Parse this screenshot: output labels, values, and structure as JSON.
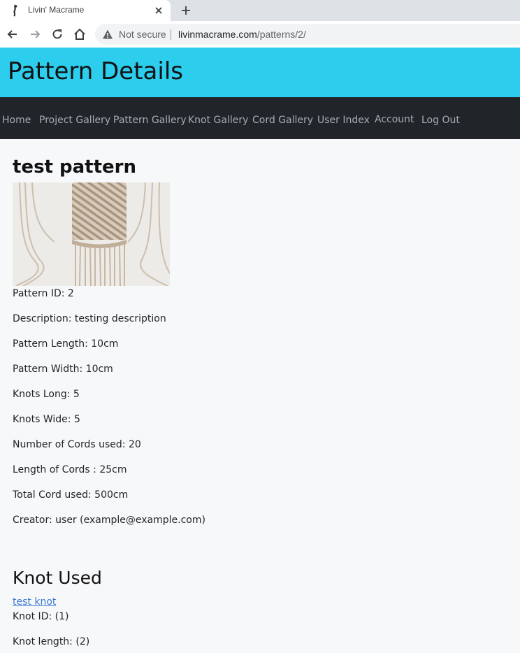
{
  "browser": {
    "tab_title": "Livin' Macrame",
    "security_label": "Not secure",
    "url_host": "livinmacrame.com",
    "url_path": "/patterns/2/"
  },
  "header": {
    "title": "Pattern Details"
  },
  "nav": {
    "items": [
      "Home",
      "Project Gallery",
      "Pattern Gallery",
      "Knot Gallery",
      "Cord Gallery",
      "User Index",
      "Account",
      "Log Out"
    ]
  },
  "pattern": {
    "name": "test pattern",
    "fields": [
      "Pattern ID: 2",
      "Description: testing description",
      "Pattern Length: 10cm",
      "Pattern Width: 10cm",
      "Knots Long: 5",
      "Knots Wide: 5",
      "Number of Cords used: 20",
      "Length of Cords : 25cm",
      "Total Cord used: 500cm",
      "Creator: user (example@example.com)"
    ]
  },
  "knot_section": {
    "heading": "Knot Used",
    "link_label": "test knot",
    "fields": [
      "Knot ID: (1)",
      "Knot length: (2)"
    ]
  },
  "colors": {
    "header_bg": "#2dcdee",
    "navbar_bg": "#212529",
    "page_bg": "#f7f8fa",
    "link": "#3b7bd4"
  }
}
